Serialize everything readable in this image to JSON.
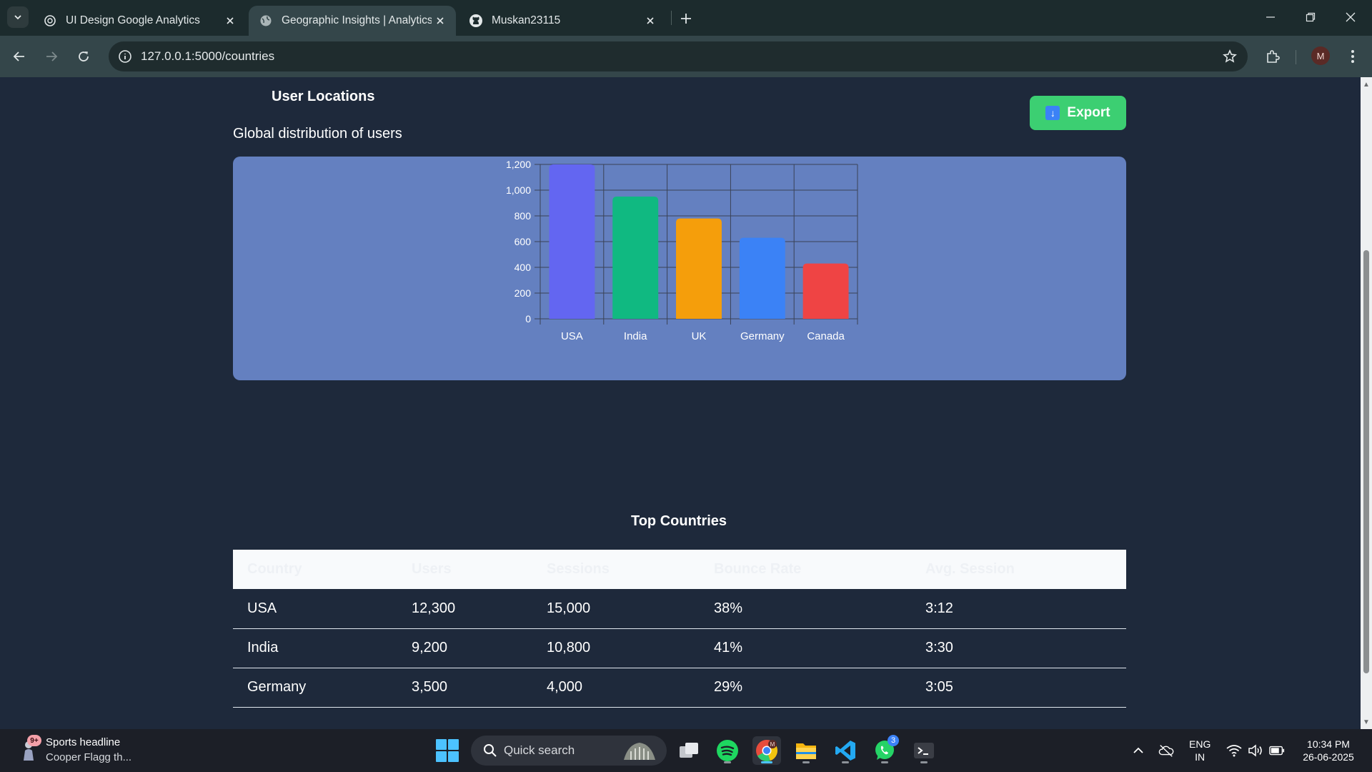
{
  "browser": {
    "tabs": [
      {
        "title": "UI Design Google Analytics",
        "icon": "chatgpt-icon",
        "active": false
      },
      {
        "title": "Geographic Insights | Analytics",
        "icon": "globe-icon",
        "active": true
      },
      {
        "title": "Muskan23115",
        "icon": "github-icon",
        "active": false
      }
    ],
    "url": "127.0.0.1:5000/countries",
    "profile_initial": "M"
  },
  "page": {
    "section_title": "User Locations",
    "export_label": "Export",
    "subtitle": "Global distribution of users",
    "table_title": "Top Countries",
    "table": {
      "headers": [
        "Country",
        "Users",
        "Sessions",
        "Bounce Rate",
        "Avg. Session"
      ],
      "rows": [
        [
          "USA",
          "12,300",
          "15,000",
          "38%",
          "3:12"
        ],
        [
          "India",
          "9,200",
          "10,800",
          "41%",
          "3:30"
        ],
        [
          "Germany",
          "3,500",
          "4,000",
          "29%",
          "3:05"
        ]
      ]
    }
  },
  "chart_data": {
    "type": "bar",
    "title": "",
    "xlabel": "",
    "ylabel": "",
    "categories": [
      "USA",
      "India",
      "UK",
      "Germany",
      "Canada"
    ],
    "values": [
      1200,
      950,
      780,
      630,
      430
    ],
    "colors": [
      "#6366f1",
      "#10b981",
      "#f59e0b",
      "#3b82f6",
      "#ef4444"
    ],
    "ylim": [
      0,
      1200
    ],
    "yticks": [
      "0",
      "200",
      "400",
      "600",
      "800",
      "1,000",
      "1,200"
    ],
    "grid": true,
    "legend": "none"
  },
  "taskbar": {
    "news_title": "Sports headline",
    "news_sub": "Cooper Flagg th...",
    "news_badge": "9+",
    "search_placeholder": "Quick search",
    "whatsapp_badge": "3",
    "lang_top": "ENG",
    "lang_bottom": "IN",
    "time": "10:34 PM",
    "date": "26-06-2025"
  }
}
